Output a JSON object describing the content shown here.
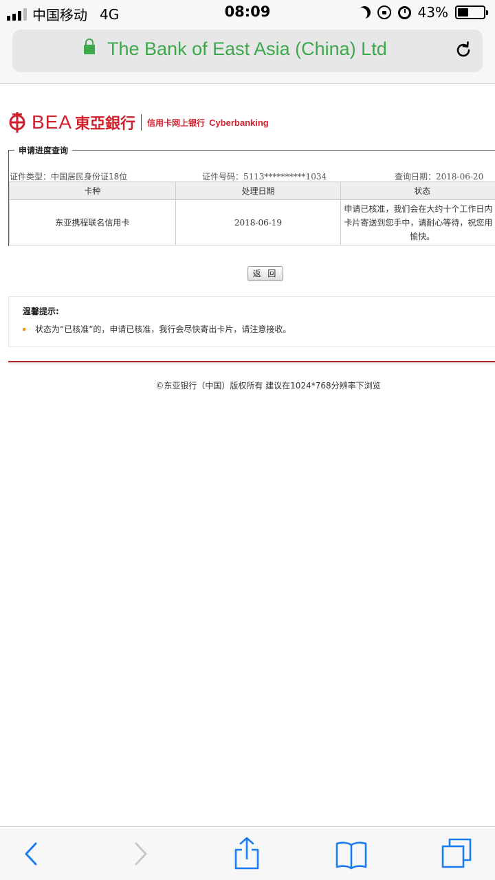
{
  "status_bar": {
    "carrier": "中国移动",
    "network": "4G",
    "time": "08:09",
    "battery": "43%",
    "battery_level": 0.43
  },
  "address_bar": {
    "site_name": "The Bank of East Asia (China) Ltd",
    "secure_color": "#3ea84d"
  },
  "logo": {
    "brand": "BEA",
    "brand_cn": "東亞銀行",
    "sub_cn": "信用卡网上银行",
    "sub_en": "Cyberbanking",
    "color": "#d0212f"
  },
  "section": {
    "legend": "申请进度查询",
    "id_type_label": "证件类型：",
    "id_type_value": "中国居民身份证18位",
    "id_no_label": "证件号码：",
    "id_no_value": "5113**********1034",
    "query_date_label": "查询日期：",
    "query_date_value": "2018-06-20"
  },
  "table": {
    "headers": [
      "卡种",
      "处理日期",
      "状态"
    ],
    "rows": [
      {
        "card": "东亚携程联名信用卡",
        "date": "2018-06-19",
        "status_line1": "申请已核准，我们会在大约十个工作日内",
        "status_line2": "卡片寄送到您手中，请耐心等待，祝您用",
        "status_line3": "愉快。"
      }
    ]
  },
  "back_button": "返 回",
  "tips": {
    "title": "温馨提示:",
    "item": "状态为“已核准”的，申请已核准，我行会尽快寄出卡片，请注意接收。"
  },
  "footer": "©东亚银行（中国）版权所有  建议在1024*768分辨率下浏览",
  "toolbar": {
    "accent": "#1a7cf2",
    "icons": [
      "back-icon",
      "forward-icon",
      "share-icon",
      "bookmarks-icon",
      "tabs-icon"
    ]
  }
}
